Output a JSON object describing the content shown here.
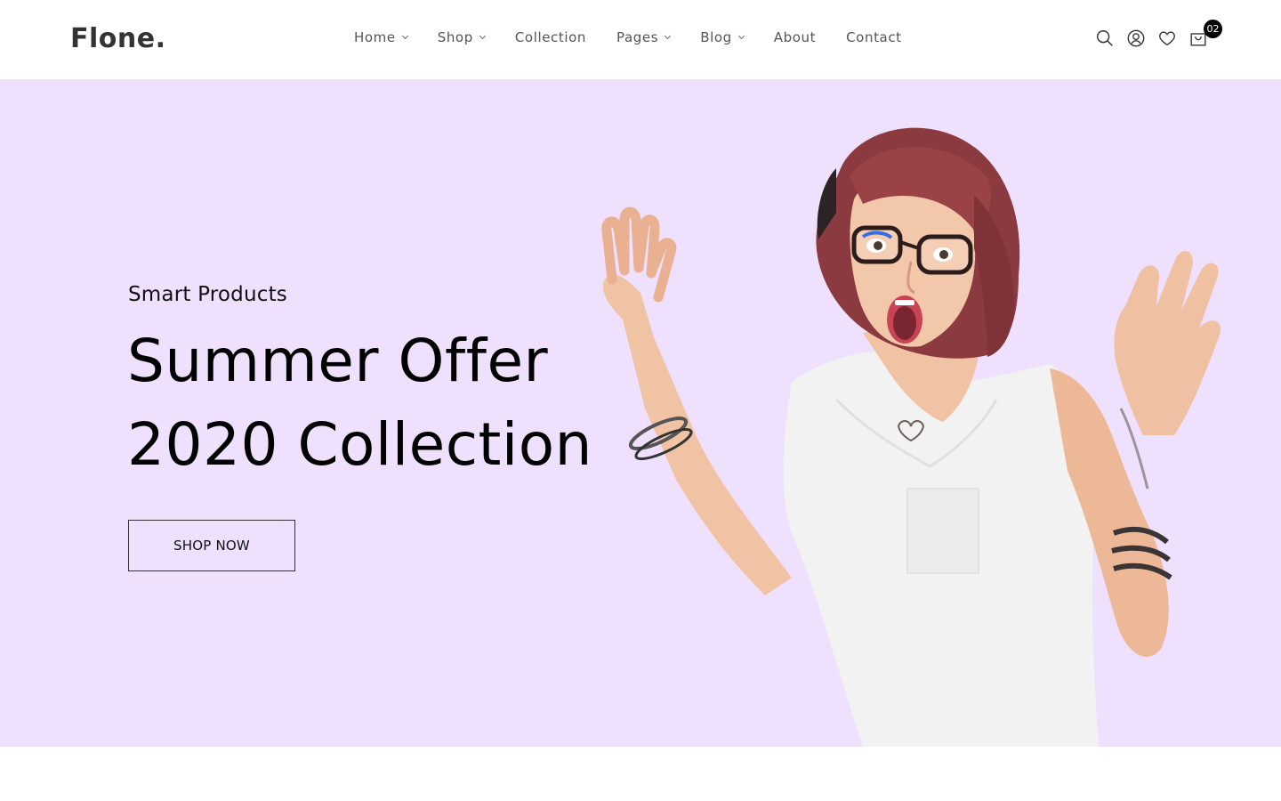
{
  "brand": {
    "logo_text": "Flone."
  },
  "nav": {
    "items": [
      {
        "label": "Home",
        "has_dropdown": true
      },
      {
        "label": "Shop",
        "has_dropdown": true
      },
      {
        "label": "Collection",
        "has_dropdown": false
      },
      {
        "label": "Pages",
        "has_dropdown": true
      },
      {
        "label": "Blog",
        "has_dropdown": true
      },
      {
        "label": "About",
        "has_dropdown": false
      },
      {
        "label": "Contact",
        "has_dropdown": false
      }
    ]
  },
  "header_icons": {
    "search": "search-icon",
    "account": "user-icon",
    "wishlist": "heart-icon",
    "cart": "shopping-bag-icon",
    "cart_count": "02"
  },
  "hero": {
    "subtitle": "Smart Products",
    "headline_line1": "Summer Offer",
    "headline_line2": "2020 Collection",
    "cta_label": "SHOP NOW",
    "background_color": "#efe0fe"
  }
}
